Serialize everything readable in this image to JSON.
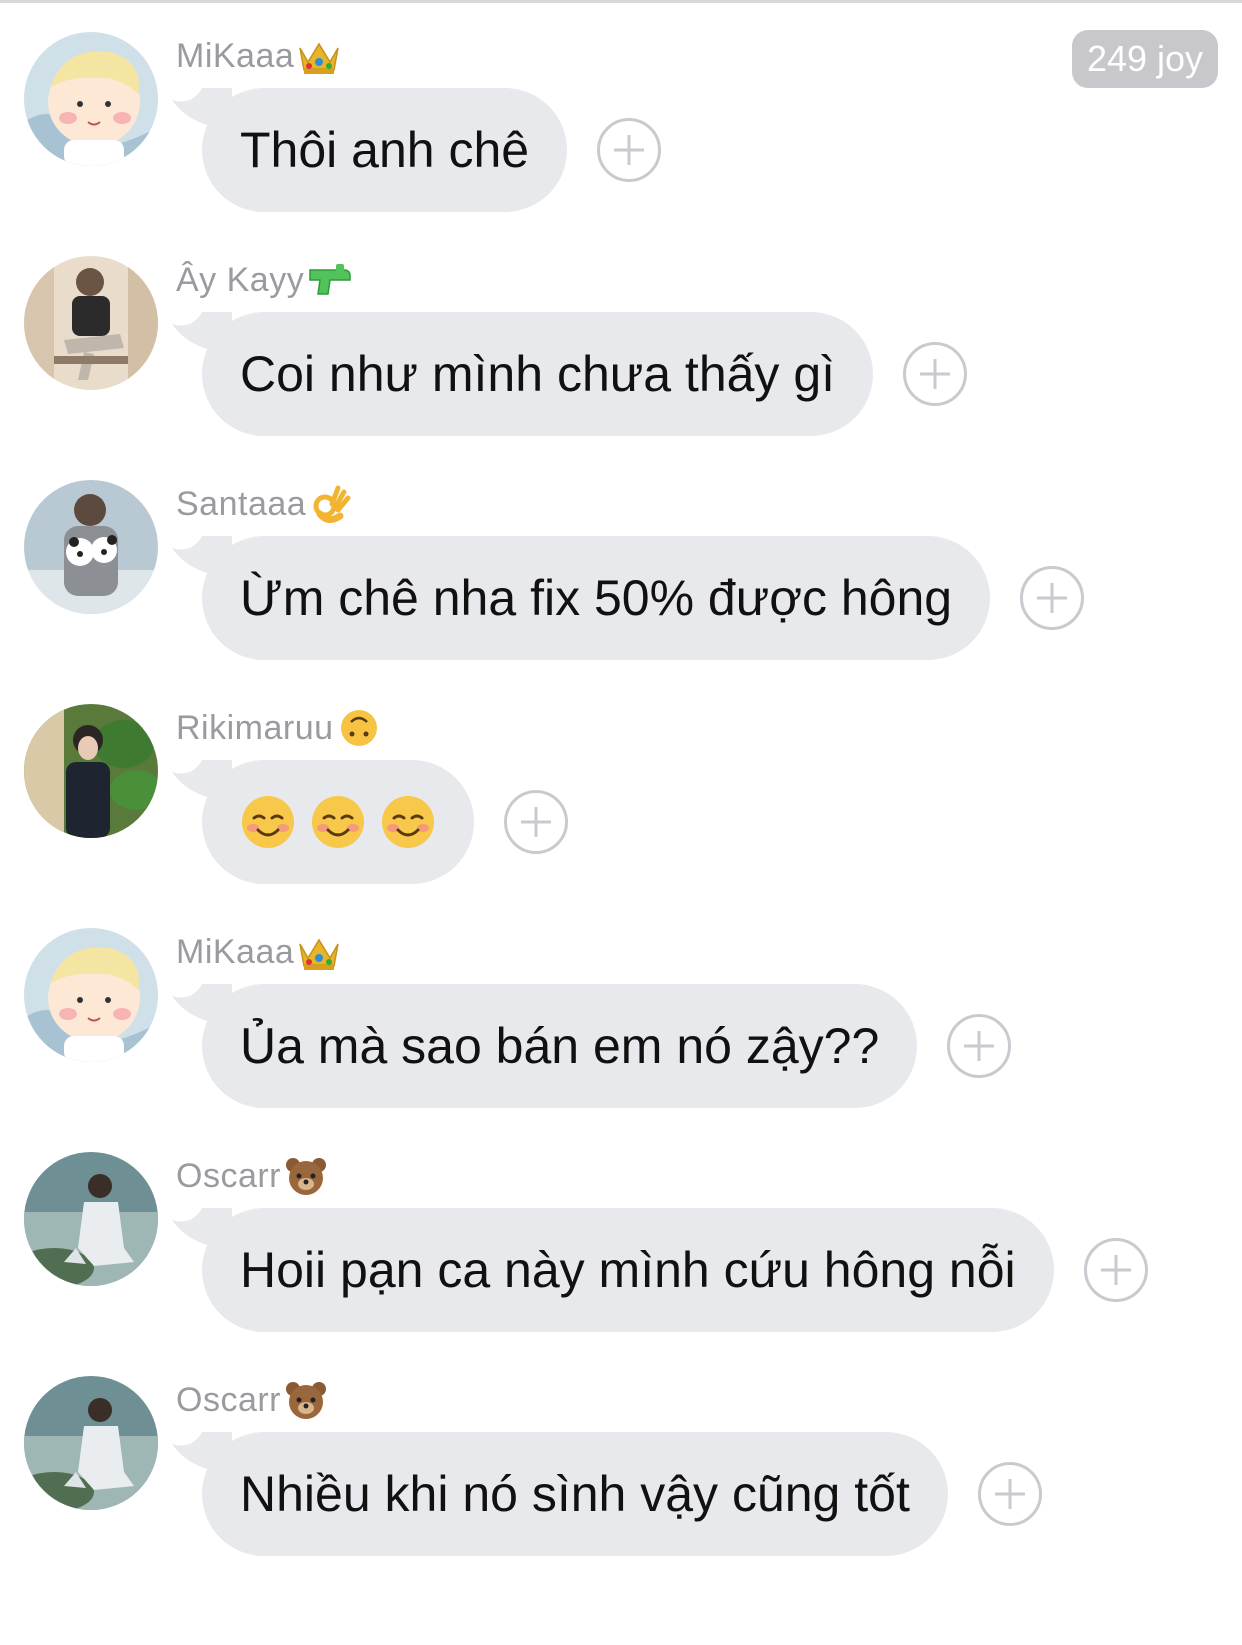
{
  "joy_badge": "249 joy",
  "messages": [
    {
      "sender": "MiKaaa",
      "badge": "crown-icon",
      "text": "Thôi anh chê",
      "avatar": "baby-cartoon"
    },
    {
      "sender": "Ây Kayy",
      "badge": "water-pistol-icon",
      "text": "Coi như mình chưa thấy gì",
      "avatar": "man-sitting"
    },
    {
      "sender": "Santaaa",
      "badge": "ok-hand-icon",
      "text": "Ừm chê nha fix 50% được hông",
      "avatar": "man-with-panda"
    },
    {
      "sender": "Rikimaruu",
      "badge": "upside-down-face-icon",
      "text": "",
      "emojis": [
        "smiling-face-icon",
        "smiling-face-icon",
        "smiling-face-icon"
      ],
      "avatar": "man-with-plant"
    },
    {
      "sender": "MiKaaa",
      "badge": "crown-icon",
      "text": "Ủa mà sao bán em nó zậy??",
      "avatar": "baby-cartoon"
    },
    {
      "sender": "Oscarr",
      "badge": "bear-face-icon",
      "text": "Hoii pạn ca này mình cứu hông nỗi",
      "avatar": "man-by-water"
    },
    {
      "sender": "Oscarr",
      "badge": "bear-face-icon",
      "text": "Nhiều khi nó sình vậy cũng tốt",
      "avatar": "man-by-water"
    }
  ]
}
